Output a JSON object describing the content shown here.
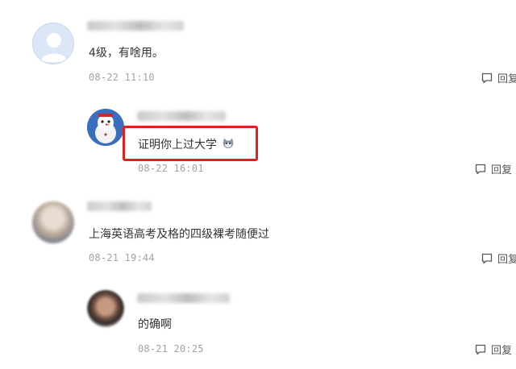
{
  "comments": [
    {
      "text": "4级，有啥用。",
      "time": "08-22 11:10",
      "reply_label": "回复"
    },
    {
      "text": "证明你上过大学",
      "emoji": "cat-emoji",
      "time": "08-22 16:01",
      "reply_label": "回复"
    },
    {
      "text": "上海英语高考及格的四级裸考随便过",
      "time": "08-21 19:44",
      "reply_label": "回复"
    },
    {
      "text": "的确啊",
      "time": "08-21 20:25",
      "reply_label": "回复"
    }
  ],
  "colors": {
    "highlight": "#e01f1f",
    "time": "#a3a3a3",
    "text": "#333333"
  }
}
